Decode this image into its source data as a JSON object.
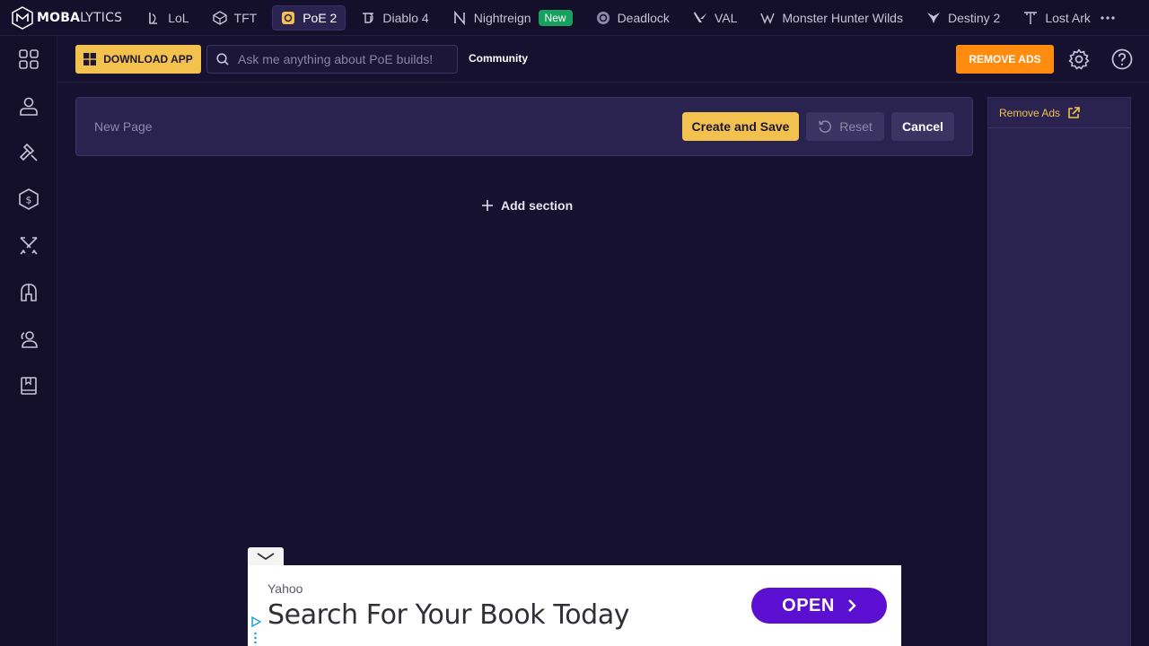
{
  "brand": {
    "bold": "MOBA",
    "light": "LYTICS"
  },
  "games": [
    {
      "label": "LoL",
      "icon": "lol-icon",
      "active": false
    },
    {
      "label": "TFT",
      "icon": "tft-icon",
      "active": false
    },
    {
      "label": "PoE 2",
      "icon": "poe2-icon",
      "active": true
    },
    {
      "label": "Diablo 4",
      "icon": "diablo4-icon",
      "active": false
    },
    {
      "label": "Nightreign",
      "icon": "nightreign-icon",
      "active": false,
      "badge": "New"
    },
    {
      "label": "Deadlock",
      "icon": "deadlock-icon",
      "active": false
    },
    {
      "label": "VAL",
      "icon": "valorant-icon",
      "active": false
    },
    {
      "label": "Monster Hunter Wilds",
      "icon": "monster-hunter-icon",
      "active": false
    },
    {
      "label": "Destiny 2",
      "icon": "destiny2-icon",
      "active": false
    },
    {
      "label": "Lost Ark",
      "icon": "lost-ark-icon",
      "active": false
    }
  ],
  "sidebar": {
    "items": [
      {
        "icon": "grid-icon"
      },
      {
        "icon": "profile-icon"
      },
      {
        "icon": "builds-hammer-icon"
      },
      {
        "icon": "currency-icon"
      },
      {
        "icon": "swords-icon"
      },
      {
        "icon": "helmet-icon"
      },
      {
        "icon": "community-people-icon"
      },
      {
        "icon": "guide-book-icon"
      }
    ]
  },
  "header": {
    "download_label": "DOWNLOAD APP",
    "search_placeholder": "Ask me anything about PoE builds!",
    "community_label": "Community",
    "remove_ads_label": "REMOVE ADS"
  },
  "editor": {
    "page_title": "New Page",
    "create_label": "Create and Save",
    "reset_label": "Reset",
    "cancel_label": "Cancel"
  },
  "add_section_label": "Add section",
  "right_panel": {
    "remove_ads_link": "Remove Ads"
  },
  "ad": {
    "source": "Yahoo",
    "headline": "Search For Your Book Today",
    "cta": "OPEN"
  },
  "colors": {
    "background": "#16112f",
    "accent_yellow": "#f2c14e",
    "remove_ads_orange": "#ff8c0f",
    "badge_green": "#17a15f",
    "ad_cta_purple": "#5b0fd0"
  }
}
